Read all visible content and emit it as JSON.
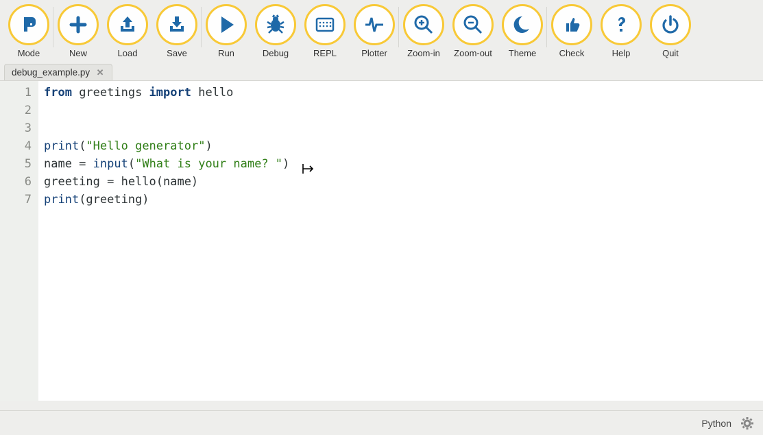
{
  "toolbar": {
    "groups": [
      [
        {
          "id": "mode",
          "label": "Mode"
        }
      ],
      [
        {
          "id": "new",
          "label": "New"
        },
        {
          "id": "load",
          "label": "Load"
        },
        {
          "id": "save",
          "label": "Save"
        }
      ],
      [
        {
          "id": "run",
          "label": "Run"
        },
        {
          "id": "debug",
          "label": "Debug"
        },
        {
          "id": "repl",
          "label": "REPL"
        },
        {
          "id": "plotter",
          "label": "Plotter"
        }
      ],
      [
        {
          "id": "zoom-in",
          "label": "Zoom-in"
        },
        {
          "id": "zoom-out",
          "label": "Zoom-out"
        },
        {
          "id": "theme",
          "label": "Theme"
        }
      ],
      [
        {
          "id": "check",
          "label": "Check"
        },
        {
          "id": "help",
          "label": "Help"
        },
        {
          "id": "quit",
          "label": "Quit"
        }
      ]
    ]
  },
  "tabs": [
    {
      "name": "debug_example.py"
    }
  ],
  "code": {
    "lines": [
      {
        "num": "1",
        "tokens": [
          {
            "t": "from ",
            "c": "kw"
          },
          {
            "t": "greetings ",
            "c": ""
          },
          {
            "t": "import ",
            "c": "kw"
          },
          {
            "t": "hello",
            "c": ""
          }
        ]
      },
      {
        "num": "2",
        "tokens": []
      },
      {
        "num": "3",
        "tokens": []
      },
      {
        "num": "4",
        "tokens": [
          {
            "t": "print",
            "c": "fn"
          },
          {
            "t": "(",
            "c": ""
          },
          {
            "t": "\"Hello generator\"",
            "c": "str"
          },
          {
            "t": ")",
            "c": ""
          }
        ]
      },
      {
        "num": "5",
        "tokens": [
          {
            "t": "name = ",
            "c": ""
          },
          {
            "t": "input",
            "c": "fn"
          },
          {
            "t": "(",
            "c": ""
          },
          {
            "t": "\"What is your name? \"",
            "c": "str"
          },
          {
            "t": ")",
            "c": ""
          }
        ]
      },
      {
        "num": "6",
        "tokens": [
          {
            "t": "greeting = hello(name)",
            "c": ""
          }
        ]
      },
      {
        "num": "7",
        "tokens": [
          {
            "t": "print",
            "c": "fn"
          },
          {
            "t": "(greeting)",
            "c": ""
          }
        ]
      }
    ]
  },
  "status": {
    "language": "Python"
  },
  "icons": {
    "mode": "mode-icon",
    "new": "plus-icon",
    "load": "upload-icon",
    "save": "download-icon",
    "run": "play-icon",
    "debug": "bug-icon",
    "repl": "keyboard-icon",
    "plotter": "pulse-icon",
    "zoom-in": "zoom-in-icon",
    "zoom-out": "zoom-out-icon",
    "theme": "moon-icon",
    "check": "thumbs-up-icon",
    "help": "question-icon",
    "quit": "power-icon"
  }
}
